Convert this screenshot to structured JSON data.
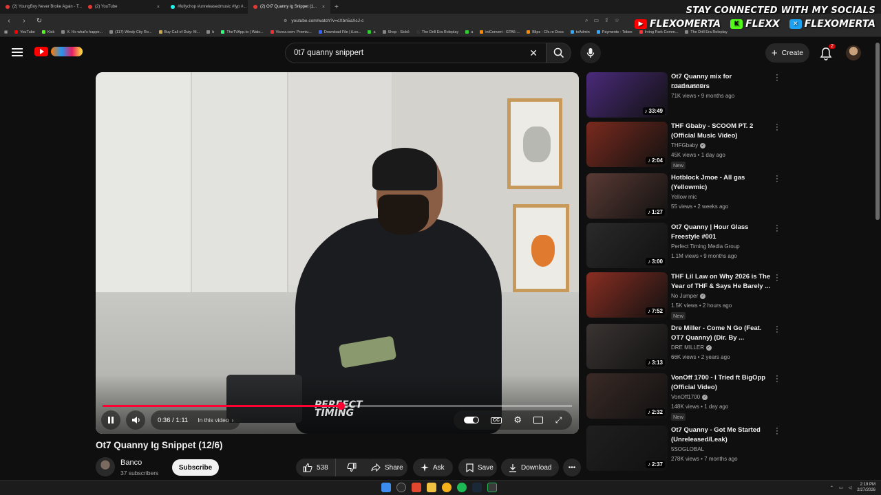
{
  "browser": {
    "tabs": [
      {
        "title": "(2) YoungBoy Never Broke Again - T..."
      },
      {
        "title": "(2) YouTube"
      },
      {
        "title": "#fullychop #unreleasedmusic #fyp #..."
      },
      {
        "title": "(2) Ot7 Quanny Ig Snippet (1..."
      }
    ],
    "new_tab": "+",
    "url": "youtube.com/watch?v=cXbn5aXcJ-c",
    "bookmarks": [
      "YouTube",
      "Kick",
      "X. It's what's happe...",
      "(117) Windy City Ro...",
      "Buy Call of Duty: M...",
      "b",
      "TheTVApp.to | Watc...",
      "Vicrez.com: Premiu...",
      "Download File | iLov...",
      "a",
      "Shop - Sickō",
      "The Drill Era Roleplay",
      "a",
      "iniConvert - GTA5-...",
      "Blips - Cfx.re Docs",
      "txAdmin",
      "Payments - Tebex",
      "Irving Park Comm...",
      "The Drill Era Roleplay"
    ]
  },
  "overlay": {
    "title": "STAY CONNECTED WITH MY SOCIALS",
    "youtube": "FLEXOMERTA",
    "kick": "FLEXX",
    "x": "FLEXOMERTA"
  },
  "header": {
    "search_value": "0t7 quanny snippert",
    "create_label": "Create",
    "notif_count": "2"
  },
  "player": {
    "progress": 0.507,
    "current_time": "0:36",
    "separator": "/",
    "duration": "1:11",
    "in_this_video": "In this video",
    "watermark_line1": "PERFECT",
    "watermark_line2": "TIMING"
  },
  "video": {
    "title": "Ot7 Quanny Ig Snippet (12/6)",
    "channel": "Banco",
    "subscribers": "37 subscribers",
    "subscribe_label": "Subscribe",
    "likes": "538",
    "share_label": "Share",
    "ask_label": "Ask",
    "save_label": "Save",
    "download_label": "Download"
  },
  "recommendations": [
    {
      "title": "Ot7 Quanny mix for roadrunners",
      "channel": "D34D L4S3R",
      "stats": "71K views • 9 months ago",
      "duration": "33:49",
      "verified": false,
      "new": "",
      "color": "#4a2a7a"
    },
    {
      "title": "THF Gbaby - SCOOM PT. 2 (Official Music Video)",
      "channel": "THFGbaby",
      "stats": "45K views • 1 day ago",
      "duration": "2:04",
      "verified": true,
      "new": "New",
      "color": "#7a2a1e"
    },
    {
      "title": "Hotblock Jmoe - All gas (Yellowmic)",
      "channel": "Yellow mic",
      "stats": "55 views • 2 weeks ago",
      "duration": "1:27",
      "verified": false,
      "new": "",
      "color": "#5a3a34"
    },
    {
      "title": "Ot7 Quanny | Hour Glass Freestyle #001",
      "channel": "Perfect Timing Media Group",
      "stats": "1.1M views • 9 months ago",
      "duration": "3:00",
      "verified": false,
      "new": "",
      "color": "#2a2a2a"
    },
    {
      "title": "THF Lil Law on Why 2026 is The Year of THF & Says He Barely ...",
      "channel": "No Jumper",
      "stats": "1.5K views • 2 hours ago",
      "duration": "7:52",
      "verified": true,
      "new": "New",
      "color": "#8a2e22"
    },
    {
      "title": "Dre Miller - Come N Go (Feat. OT7 Quanny) (Dir. By ...",
      "channel": "DRE MILLER",
      "stats": "66K views • 2 years ago",
      "duration": "3:13",
      "verified": true,
      "new": "",
      "color": "#3a3432"
    },
    {
      "title": "VonOff 1700 - I Tried ft BigOpp (Official Video)",
      "channel": "VonOff1700",
      "stats": "148K views • 1 day ago",
      "duration": "2:32",
      "verified": true,
      "new": "New",
      "color": "#3a2a26"
    },
    {
      "title": "Ot7 Quanny - Got Me Started (Unreleased/Leak)",
      "channel": "5SOGLOBAL",
      "stats": "278K views • 7 months ago",
      "duration": "2:37",
      "verified": false,
      "new": "",
      "color": "#1f1f1f"
    }
  ],
  "taskbar": {
    "time": "2:19 PM",
    "date": "2/27/2026"
  }
}
